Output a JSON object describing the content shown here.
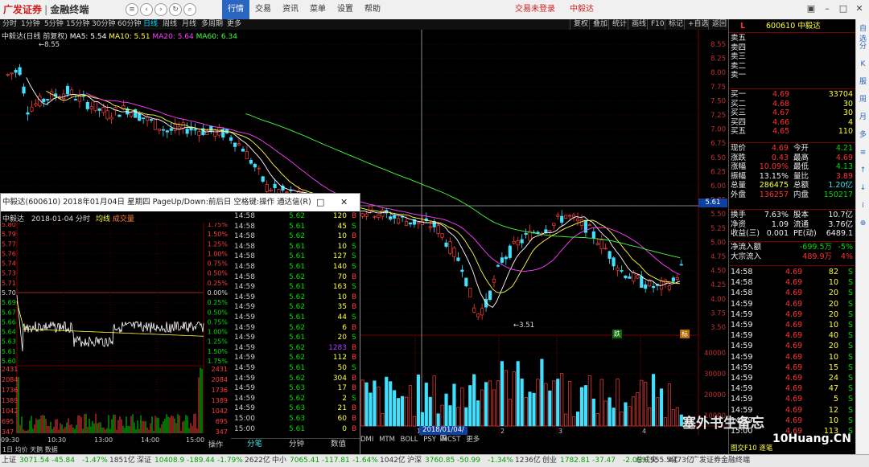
{
  "app": {
    "logo_brand": "广发证券",
    "logo_terminal": "金融终端",
    "menus": [
      "行情",
      "交易",
      "资讯",
      "菜单",
      "设置",
      "帮助"
    ],
    "trade_status": "交易未登录",
    "stock_name_title": "中毅达"
  },
  "toolbar": {
    "periods": [
      "分时",
      "1分钟",
      "5分钟",
      "15分钟",
      "30分钟",
      "60分钟",
      "日线",
      "周线",
      "月线",
      "多周期",
      "更多"
    ],
    "active_period": "日线",
    "right_buttons": [
      "复权",
      "叠加",
      "统计",
      "画线",
      "F10",
      "标记",
      "+自选",
      "返回"
    ]
  },
  "kline": {
    "header_name": "中毅达(日线 前复权)",
    "ma_labels": [
      {
        "text": "MA5: 5.54",
        "color": "#ffffff"
      },
      {
        "text": "MA10: 5.51",
        "color": "#ffff40"
      },
      {
        "text": "MA20: 5.64",
        "color": "#ff40ff"
      },
      {
        "text": "MA60: 6.34",
        "color": "#40ff40"
      }
    ],
    "price_ticks": [
      "8.55",
      "8.25",
      "8.00",
      "7.75",
      "7.50",
      "7.25",
      "7.00",
      "6.75",
      "6.50",
      "6.25",
      "6.00",
      "5.75",
      "5.50",
      "5.25",
      "5.00",
      "4.75",
      "4.50",
      "4.25",
      "4.00",
      "3.75",
      "3.50"
    ],
    "high_marker": "8.55",
    "low_marker": "3.51",
    "cursor_price": "5.61",
    "cursor_date": "2018/01/04/四",
    "badge_down": "跌",
    "badge_mark": "标",
    "volume_ticks": [
      "40000",
      "30000",
      "20000",
      "10000"
    ],
    "x_marks": [
      "1",
      "2",
      "3",
      "4"
    ],
    "indicator_tabs": [
      "DMI",
      "MTM",
      "BOLL",
      "PSY",
      "MCST",
      "更多"
    ]
  },
  "popup": {
    "title": "中毅达(600610) 2018年01月04日 星期四 PageUp/Down:前后日 空格键:操作 通达信(R)",
    "header_name": "中毅达",
    "header_date": "2018-01-04 分时",
    "header_avg": "均线",
    "header_vol": "成交量",
    "left_prices": [
      "5.80",
      "5.79",
      "5.77",
      "5.76",
      "5.74",
      "5.73",
      "5.71",
      "5.70",
      "5.69",
      "5.67",
      "5.66",
      "5.64",
      "5.63",
      "5.61",
      "5.60"
    ],
    "right_pcts": [
      "1.75%",
      "1.50%",
      "1.25%",
      "1.00%",
      "0.75%",
      "0.50%",
      "0.25%",
      "0.00%",
      "0.25%",
      "0.50%",
      "0.75%",
      "1.00%",
      "1.25%",
      "1.50%",
      "1.75%"
    ],
    "vol_ticks": [
      "2431",
      "2084",
      "1736",
      "1389",
      "1042",
      "695",
      "347"
    ],
    "time_ticks": [
      "09:30",
      "10:30",
      "13:00",
      "14:00",
      "15:00"
    ],
    "bottom_left": "1日 均价 天鹅 数据",
    "operate": "操作",
    "tabs": [
      "分笔",
      "分钟",
      "数值"
    ],
    "ticks": [
      {
        "t": "14:58",
        "p": "5.62",
        "v": "120",
        "d": "B"
      },
      {
        "t": "14:58",
        "p": "5.61",
        "v": "45",
        "d": "S"
      },
      {
        "t": "14:58",
        "p": "5.62",
        "v": "10",
        "d": "B"
      },
      {
        "t": "14:58",
        "p": "5.61",
        "v": "10",
        "d": "S"
      },
      {
        "t": "14:58",
        "p": "5.61",
        "v": "127",
        "d": "S"
      },
      {
        "t": "14:58",
        "p": "5.61",
        "v": "140",
        "d": "S"
      },
      {
        "t": "14:58",
        "p": "5.62",
        "v": "70",
        "d": "B"
      },
      {
        "t": "14:59",
        "p": "5.61",
        "v": "163",
        "d": "S"
      },
      {
        "t": "14:59",
        "p": "5.62",
        "v": "10",
        "d": "B"
      },
      {
        "t": "14:59",
        "p": "5.62",
        "v": "35",
        "d": "B"
      },
      {
        "t": "14:59",
        "p": "5.61",
        "v": "44",
        "d": "S"
      },
      {
        "t": "14:59",
        "p": "5.62",
        "v": "6",
        "d": "B"
      },
      {
        "t": "14:59",
        "p": "5.61",
        "v": "20",
        "d": "S"
      },
      {
        "t": "14:59",
        "p": "5.62",
        "v": "1283",
        "d": "B"
      },
      {
        "t": "14:59",
        "p": "5.62",
        "v": "112",
        "d": "B"
      },
      {
        "t": "14:59",
        "p": "5.61",
        "v": "50",
        "d": "S"
      },
      {
        "t": "14:59",
        "p": "5.62",
        "v": "304",
        "d": "B"
      },
      {
        "t": "14:59",
        "p": "5.63",
        "v": "17",
        "d": "B"
      },
      {
        "t": "14:59",
        "p": "5.62",
        "v": "2",
        "d": "S"
      },
      {
        "t": "14:59",
        "p": "5.63",
        "v": "21",
        "d": "B"
      },
      {
        "t": "15:00",
        "p": "5.63",
        "v": "60",
        "d": "B"
      },
      {
        "t": "15:00",
        "p": "5.61",
        "v": "0",
        "d": "B"
      }
    ]
  },
  "quote": {
    "flag": "L",
    "code_name": "600610 中毅达",
    "sells": [
      "卖五",
      "卖四",
      "卖三",
      "卖二",
      "卖一"
    ],
    "buys": [
      {
        "label": "买一",
        "price": "4.69",
        "vol": "33704"
      },
      {
        "label": "买二",
        "price": "4.68",
        "vol": "30"
      },
      {
        "label": "买三",
        "price": "4.67",
        "vol": "30"
      },
      {
        "label": "买四",
        "price": "4.66",
        "vol": "4"
      },
      {
        "label": "买五",
        "price": "4.65",
        "vol": "110"
      }
    ],
    "stats": [
      {
        "l1": "现价",
        "v1": "4.69",
        "c1": "red",
        "l2": "今开",
        "v2": "4.21",
        "c2": "green"
      },
      {
        "l1": "涨跌",
        "v1": "0.43",
        "c1": "red",
        "l2": "最高",
        "v2": "4.69",
        "c2": "red"
      },
      {
        "l1": "涨幅",
        "v1": "10.09%",
        "c1": "red",
        "l2": "最低",
        "v2": "4.13",
        "c2": "green"
      },
      {
        "l1": "振幅",
        "v1": "13.15%",
        "c1": "white",
        "l2": "量比",
        "v2": "3.89",
        "c2": "red"
      },
      {
        "l1": "总量",
        "v1": "286475",
        "c1": "yellow",
        "l2": "总额",
        "v2": "1.20亿",
        "c2": "cyan"
      },
      {
        "l1": "外盘",
        "v1": "136257",
        "c1": "red",
        "l2": "内盘",
        "v2": "150217",
        "c2": "green"
      }
    ],
    "stats2": [
      {
        "l1": "换手",
        "v1": "7.63%",
        "l2": "股本",
        "v2": "10.7亿"
      },
      {
        "l1": "净资",
        "v1": "1.09",
        "l2": "流通",
        "v2": "3.76亿"
      },
      {
        "l1": "收益(三)",
        "v1": "0.001",
        "l2": "PE(动)",
        "v2": "6489.1"
      }
    ],
    "flows": [
      {
        "label": "净流入额",
        "value": "-699.5万",
        "pct": "-5%"
      },
      {
        "label": "大宗流入",
        "value": "489.9万",
        "pct": "4%"
      }
    ],
    "ticks": [
      {
        "t": "14:58",
        "p": "4.69",
        "v": "82",
        "d": "S"
      },
      {
        "t": "14:58",
        "p": "4.69",
        "v": "10",
        "d": "S"
      },
      {
        "t": "14:58",
        "p": "4.69",
        "v": "20",
        "d": "S"
      },
      {
        "t": "14:59",
        "p": "4.69",
        "v": "20",
        "d": "S"
      },
      {
        "t": "14:59",
        "p": "4.69",
        "v": "20",
        "d": "S"
      },
      {
        "t": "14:59",
        "p": "4.69",
        "v": "10",
        "d": "S"
      },
      {
        "t": "14:59",
        "p": "4.69",
        "v": "40",
        "d": "S"
      },
      {
        "t": "14:59",
        "p": "4.69",
        "v": "20",
        "d": "S"
      },
      {
        "t": "14:59",
        "p": "4.69",
        "v": "10",
        "d": "S"
      },
      {
        "t": "14:59",
        "p": "4.69",
        "v": "15",
        "d": "S"
      },
      {
        "t": "14:59",
        "p": "4.69",
        "v": "24",
        "d": "S"
      },
      {
        "t": "14:59",
        "p": "4.69",
        "v": "47",
        "d": "S"
      },
      {
        "t": "14:59",
        "p": "4.69",
        "v": "5",
        "d": "S"
      },
      {
        "t": "14:59",
        "p": "4.69",
        "v": "12",
        "d": "S"
      },
      {
        "t": "14:59",
        "p": "4.69",
        "v": "10",
        "d": "S"
      },
      {
        "t": "15:00",
        "p": "4.69",
        "v": "113",
        "d": "S"
      }
    ],
    "bottom_label": "图交F10 逐笔"
  },
  "side_icons": [
    "自选",
    "分",
    "K",
    "服",
    "周",
    "月",
    "多",
    "≡",
    "↑",
    "↓",
    "i",
    "⊕"
  ],
  "status": [
    {
      "label": "上证",
      "value": "3071.54",
      "chg": "-45.84",
      "pct": "-1.47%",
      "amt": "1851亿"
    },
    {
      "label": "深证",
      "value": "10408.9",
      "chg": "-189.44",
      "pct": "-1.79%",
      "amt": "2622亿"
    },
    {
      "label": "中小",
      "value": "7065.41",
      "chg": "-117.81",
      "pct": "-1.64%",
      "amt": "1042亿"
    },
    {
      "label": "沪深",
      "value": "3760.85",
      "chg": "-50.99",
      "pct": "-1.34%",
      "amt": "1236亿"
    },
    {
      "label": "创业",
      "value": "1782.81",
      "chg": "-37.47",
      "pct": "-2.06%",
      "amt": "955.5亿"
    }
  ],
  "status_right": [
    "总成交",
    "4473亿",
    "广发证券金融终端"
  ],
  "watermark": {
    "text1": "塞外书生备忘",
    "text2": "10Huang.CN"
  }
}
